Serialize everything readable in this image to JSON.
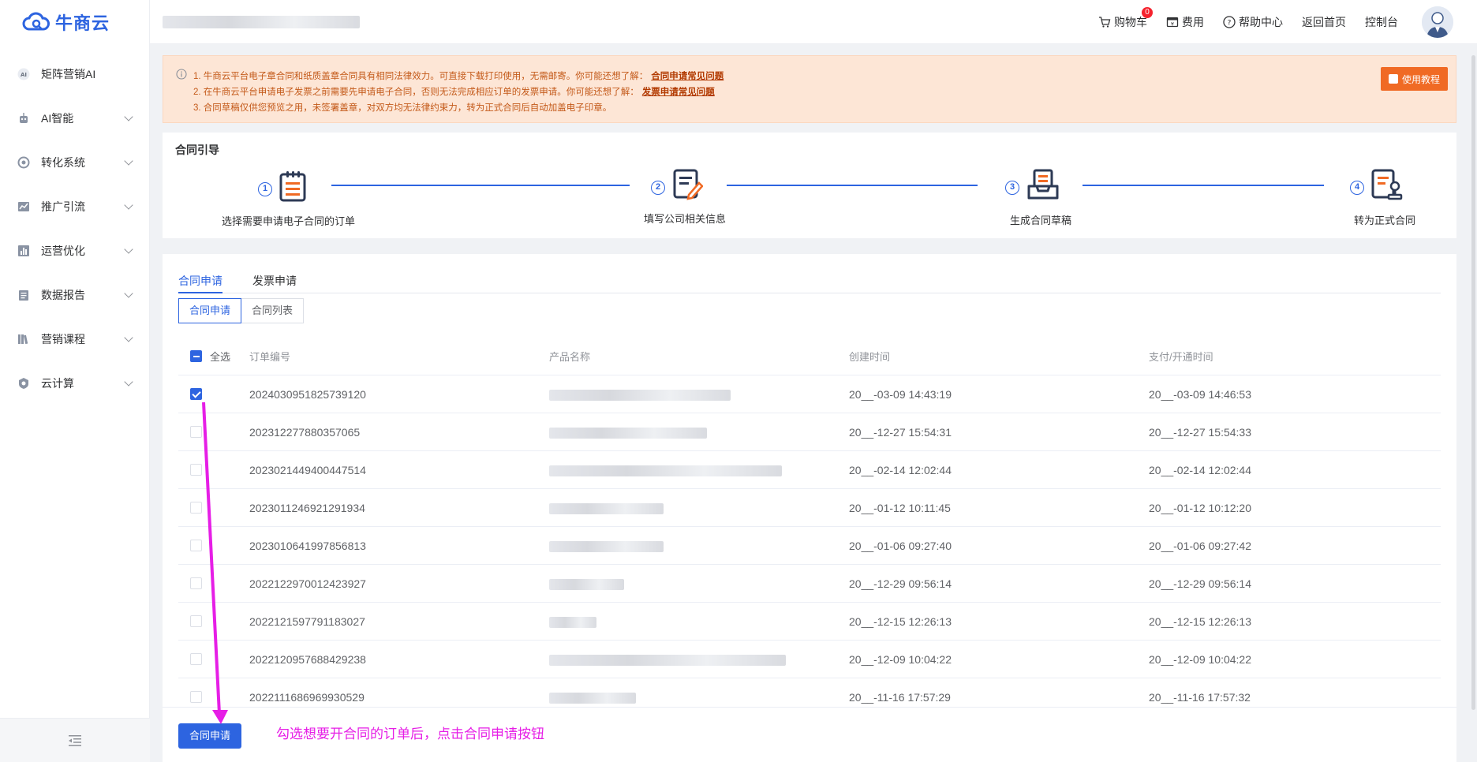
{
  "brand": {
    "name": "牛商云",
    "color": "#2d64e0"
  },
  "sidebar": {
    "items": [
      {
        "label": "矩阵营销AI",
        "icon": "ai-icon",
        "expandable": false
      },
      {
        "label": "AI智能",
        "icon": "robot-icon",
        "expandable": true
      },
      {
        "label": "转化系统",
        "icon": "convert-icon",
        "expandable": true
      },
      {
        "label": "推广引流",
        "icon": "trend-icon",
        "expandable": true
      },
      {
        "label": "运营优化",
        "icon": "bar-chart-icon",
        "expandable": true
      },
      {
        "label": "数据报告",
        "icon": "report-icon",
        "expandable": true
      },
      {
        "label": "营销课程",
        "icon": "books-icon",
        "expandable": true
      },
      {
        "label": "云计算",
        "icon": "cloud-shield-icon",
        "expandable": true
      }
    ]
  },
  "header": {
    "cart": {
      "label": "购物车",
      "count": "0"
    },
    "fee": "费用",
    "help": "帮助中心",
    "home": "返回首页",
    "console": "控制台"
  },
  "notice": {
    "line1": "1. 牛商云平台电子章合同和纸质盖章合同具有相同法律效力。可直接下载打印使用，无需邮寄。你可能还想了解：",
    "link1": "合同申请常见问题",
    "line2": "2. 在牛商云平台申请电子发票之前需要先申请电子合同，否则无法完成相应订单的发票申请。你可能还想了解：",
    "link2": "发票申请常见问题",
    "line3": "3. 合同草稿仅供您预览之用，未签署盖章，对双方均无法律约束力，转为正式合同后自动加盖电子印章。",
    "tutorial_label": "使用教程"
  },
  "guide": {
    "title": "合同引导",
    "steps": [
      {
        "num": "1",
        "label": "选择需要申请电子合同的订单"
      },
      {
        "num": "2",
        "label": "填写公司相关信息"
      },
      {
        "num": "3",
        "label": "生成合同草稿"
      },
      {
        "num": "4",
        "label": "转为正式合同"
      }
    ]
  },
  "tabs": [
    "合同申请",
    "发票申请"
  ],
  "segments": [
    "合同申请",
    "合同列表"
  ],
  "table": {
    "select_all": "全选",
    "columns": [
      "订单编号",
      "产品名称",
      "创建时间",
      "支付/开通时间"
    ],
    "rows": [
      {
        "order": "2024030951825739120",
        "created": "20__-03-09 14:43:19",
        "paid": "20__-03-09 14:46:53",
        "checked": true
      },
      {
        "order": "202312277880357065",
        "created": "20__-12-27 15:54:31",
        "paid": "20__-12-27 15:54:33",
        "checked": false
      },
      {
        "order": "2023021449400447514",
        "created": "20__-02-14 12:02:44",
        "paid": "20__-02-14 12:02:44",
        "checked": false
      },
      {
        "order": "2023011246921291934",
        "created": "20__-01-12 10:11:45",
        "paid": "20__-01-12 10:12:20",
        "checked": false
      },
      {
        "order": "2023010641997856813",
        "created": "20__-01-06 09:27:40",
        "paid": "20__-01-06 09:27:42",
        "checked": false
      },
      {
        "order": "2022122970012423927",
        "created": "20__-12-29 09:56:14",
        "paid": "20__-12-29 09:56:14",
        "checked": false
      },
      {
        "order": "2022121597791183027",
        "created": "20__-12-15 12:26:13",
        "paid": "20__-12-15 12:26:13",
        "checked": false
      },
      {
        "order": "2022120957688429238",
        "created": "20__-12-09 10:04:22",
        "paid": "20__-12-09 10:04:22",
        "checked": false
      },
      {
        "order": "2022111686969930529",
        "created": "20__-11-16 17:57:29",
        "paid": "20__-11-16 17:57:32",
        "checked": false
      }
    ]
  },
  "footer": {
    "apply_label": "合同申请"
  },
  "annotation": {
    "text": "勾选想要开合同的订单后，点击合同申请按钮",
    "color": "#e61ee6"
  }
}
